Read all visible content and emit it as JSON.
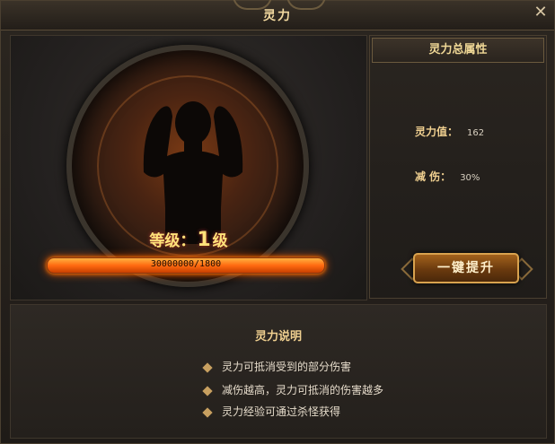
{
  "window": {
    "title": "灵力",
    "close_symbol": "✕"
  },
  "hero": {
    "level_label": "等级：",
    "level_value": "1",
    "level_unit": "级",
    "exp_text": "30000000/1800",
    "exp_progress": 1.0
  },
  "attributes": {
    "header": "灵力总属性",
    "rows": [
      {
        "label": "灵力值：",
        "value": "162"
      },
      {
        "label": "减  伤：",
        "value": "30%"
      }
    ],
    "upgrade_button": "一键提升"
  },
  "description": {
    "title": "灵力说明",
    "items": [
      "灵力可抵消受到的部分伤害",
      "减伤越高，灵力可抵消的伤害越多",
      "灵力经验可通过杀怪获得"
    ]
  },
  "colors": {
    "accent_gold": "#f0d090",
    "exp_orange": "#ff6a10",
    "level_yellow": "#ffe27a"
  }
}
